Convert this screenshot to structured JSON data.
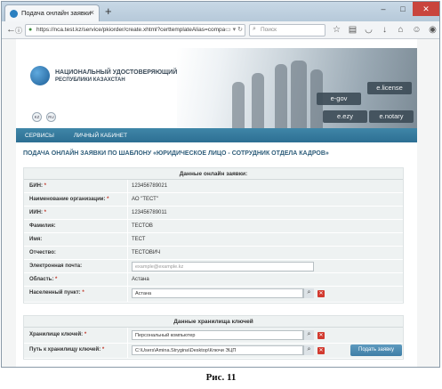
{
  "browser": {
    "tab_title": "Подача онлайн заявки",
    "tab_close": "×",
    "new_tab": "+",
    "url": "https://nca.test.kz/service/pkiorder/create.xhtml?certtemplateAlias=company_hr",
    "search_placeholder": "Поиск",
    "window_controls": {
      "minimize": "–",
      "maximize": "□",
      "close": "✕"
    }
  },
  "site": {
    "company_title_line1": "НАЦИОНАЛЬНЫЙ УДОСТОВЕРЯЮЩИЙ ЦЕНТР",
    "company_title_line2": "РЕСПУБЛИКИ КАЗАХСТАН",
    "lang_kz": "KZ",
    "lang_ru": "RU",
    "banner_buttons": [
      "e-gov",
      "e.license",
      "e.ezy",
      "e.notary"
    ],
    "menu": [
      "СЕРВИСЫ",
      "ЛИЧНЫЙ КАБИНЕТ"
    ],
    "page_title": "ПОДАЧА ОНЛАЙН ЗАЯВКИ ПО ШАБЛОНУ «ЮРИДИЧЕСКОЕ ЛИЦО - СОТРУДНИК ОТДЕЛА КАДРОВ»"
  },
  "application": {
    "header": "Данные онлайн заявки:",
    "bin_label": "БИН:",
    "bin_value": "123456789021",
    "org_label": "Наименование организации:",
    "org_value": "АО \"ТЕСТ\"",
    "iin_label": "ИИН:",
    "iin_value": "123456789011",
    "surname_label": "Фамилия:",
    "surname_value": "ТЕСТОВ",
    "name_label": "Имя:",
    "name_value": "ТЕСТ",
    "patronymic_label": "Отчество:",
    "patronymic_value": "ТЕСТОВИЧ",
    "email_label": "Электронная почта:",
    "email_placeholder": "example@example.kz",
    "region_label": "Область:",
    "region_value": "Астана",
    "locality_label": "Населенный пункт:",
    "locality_value": "Астана"
  },
  "storage": {
    "header": "Данные хранилища ключей",
    "storage_label": "Хранилище ключей:",
    "storage_value": "Персональный компьютер",
    "path_label": "Путь к хранилищу ключей:",
    "path_value": "C:\\Users\\Amina.Strygina\\Desktop\\Ключи ЭЦП",
    "submit_label": "Подать заявку"
  },
  "required_mark": "*",
  "caption": "Рис. 11"
}
